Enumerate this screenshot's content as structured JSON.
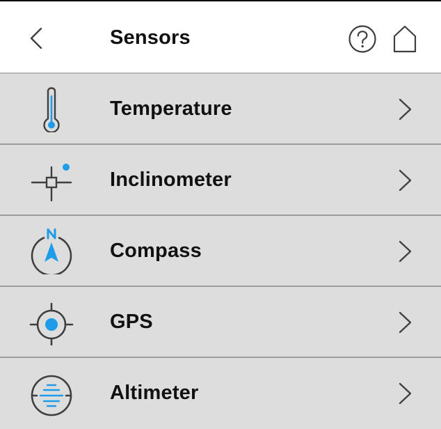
{
  "header": {
    "title": "Sensors",
    "back_icon": "chevron-left-icon",
    "help_icon": "question-mark-circle-icon",
    "home_icon": "home-icon"
  },
  "sensors": [
    {
      "label": "Temperature",
      "icon": "thermometer-icon"
    },
    {
      "label": "Inclinometer",
      "icon": "crosshair-level-icon"
    },
    {
      "label": "Compass",
      "icon": "compass-north-icon"
    },
    {
      "label": "GPS",
      "icon": "gps-target-icon"
    },
    {
      "label": "Altimeter",
      "icon": "altimeter-icon"
    }
  ],
  "colors": {
    "accent": "#1e9be9",
    "icon_stroke": "#3f3f3f",
    "row_background": "#dddddd",
    "divider": "#9c9c9c",
    "header_background": "#ffffff"
  }
}
